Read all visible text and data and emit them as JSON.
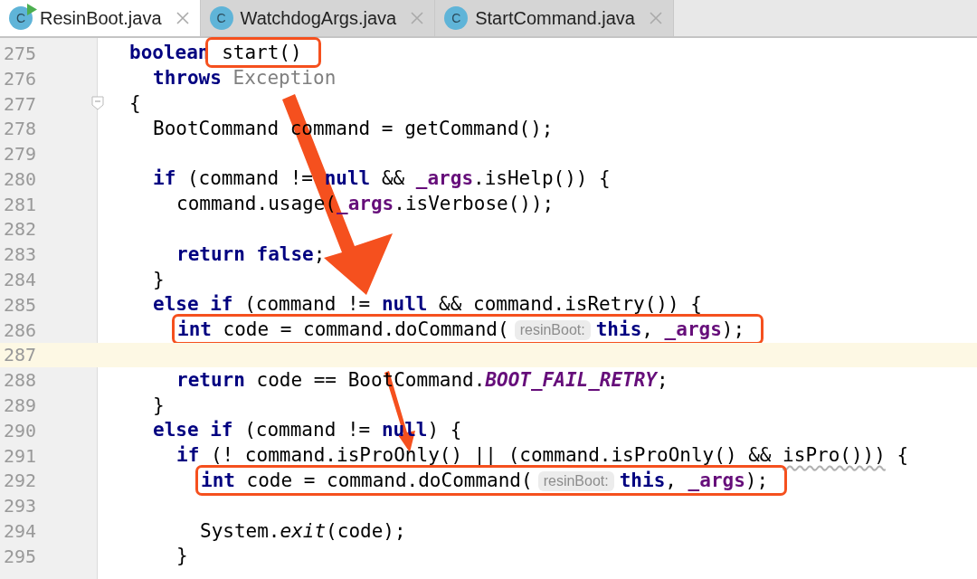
{
  "tabs": [
    {
      "label": "ResinBoot.java",
      "icon": "C",
      "runnable": true,
      "selected": true
    },
    {
      "label": "WatchdogArgs.java",
      "icon": "C",
      "runnable": false,
      "selected": false
    },
    {
      "label": "StartCommand.java",
      "icon": "C",
      "runnable": false,
      "selected": false
    }
  ],
  "editor": {
    "lines": [
      {
        "number": "275",
        "current": false,
        "fold": false,
        "tokens": [
          {
            "t": "boolean",
            "kind": "kw"
          },
          {
            "kind": "box",
            "tokens": [
              {
                "t": " start()",
                "kind": "plain"
              }
            ]
          }
        ],
        "children": [
          {
            "number": "276",
            "current": false,
            "fold": false,
            "tokens": [
              {
                "t": "throws",
                "kind": "kw"
              },
              {
                "t": " Exception",
                "kind": "gray"
              }
            ]
          }
        ]
      },
      {
        "number": "277",
        "current": false,
        "fold": true,
        "tokens": [
          {
            "t": "{",
            "kind": "plain"
          }
        ],
        "children": [
          {
            "number": "278",
            "current": false,
            "fold": false,
            "tokens": [
              {
                "t": "BootCommand command = getCommand();",
                "kind": "plain"
              }
            ]
          },
          {
            "number": "279",
            "current": false,
            "fold": false
          },
          {
            "number": "280",
            "current": false,
            "fold": false,
            "tokens": [
              {
                "t": "if",
                "kind": "kw"
              },
              {
                "t": " (command != ",
                "kind": "plain"
              },
              {
                "t": "null",
                "kind": "kw"
              },
              {
                "t": " && ",
                "kind": "plain"
              },
              {
                "t": "_args",
                "kind": "param"
              },
              {
                "t": ".isHelp()) {",
                "kind": "plain"
              }
            ],
            "children": [
              {
                "number": "281",
                "current": false,
                "fold": false,
                "tokens": [
                  {
                    "t": "command.usage(",
                    "kind": "plain"
                  },
                  {
                    "t": "_args",
                    "kind": "param"
                  },
                  {
                    "t": ".isVerbose());",
                    "kind": "plain"
                  }
                ]
              },
              {
                "number": "282",
                "current": false,
                "fold": false
              },
              {
                "number": "283",
                "current": false,
                "fold": false,
                "tokens": [
                  {
                    "t": "return false",
                    "kind": "kw"
                  },
                  {
                    "t": ";",
                    "kind": "plain"
                  }
                ]
              }
            ]
          },
          {
            "number": "284",
            "current": false,
            "fold": false,
            "tokens": [
              {
                "t": "}",
                "kind": "plain"
              }
            ]
          },
          {
            "number": "285",
            "current": false,
            "fold": false,
            "tokens": [
              {
                "t": "else if",
                "kind": "kw"
              },
              {
                "t": " (command != ",
                "kind": "plain"
              },
              {
                "t": "null",
                "kind": "kw"
              },
              {
                "t": " && command.isRetry()) {",
                "kind": "plain"
              }
            ],
            "children": [
              {
                "number": "286",
                "current": false,
                "fold": false,
                "tokens": [
                  {
                    "kind": "box",
                    "tokens": [
                      {
                        "t": "int",
                        "kind": "kw"
                      },
                      {
                        "t": " code = command.doCommand(",
                        "kind": "plain"
                      },
                      {
                        "t": "resinBoot:",
                        "kind": "hint"
                      },
                      {
                        "t": "this",
                        "kind": "kw"
                      },
                      {
                        "t": ", ",
                        "kind": "plain"
                      },
                      {
                        "t": "_args",
                        "kind": "param"
                      },
                      {
                        "t": ");",
                        "kind": "plain"
                      }
                    ]
                  }
                ]
              },
              {
                "number": "287",
                "current": true,
                "fold": false
              },
              {
                "number": "288",
                "current": false,
                "fold": false,
                "tokens": [
                  {
                    "t": "return",
                    "kind": "kw"
                  },
                  {
                    "t": " code == BootCommand.",
                    "kind": "plain"
                  },
                  {
                    "t": "BOOT_FAIL_RETRY",
                    "kind": "field"
                  },
                  {
                    "t": ";",
                    "kind": "plain"
                  }
                ]
              }
            ]
          },
          {
            "number": "289",
            "current": false,
            "fold": false,
            "tokens": [
              {
                "t": "}",
                "kind": "plain"
              }
            ]
          },
          {
            "number": "290",
            "current": false,
            "fold": false,
            "tokens": [
              {
                "t": "else if",
                "kind": "kw"
              },
              {
                "t": " (command != ",
                "kind": "plain"
              },
              {
                "t": "null",
                "kind": "kw"
              },
              {
                "t": ") {",
                "kind": "plain"
              }
            ],
            "children": [
              {
                "number": "291",
                "current": false,
                "fold": false,
                "tokens": [
                  {
                    "t": "if",
                    "kind": "kw"
                  },
                  {
                    "t": " (! command.isProOnly() || (command.isProOnly() && ",
                    "kind": "plain"
                  },
                  {
                    "t": "isPro()))",
                    "kind": "warn"
                  },
                  {
                    "t": " {",
                    "kind": "plain"
                  }
                ],
                "children": [
                  {
                    "number": "292",
                    "current": false,
                    "fold": false,
                    "tokens": [
                      {
                        "kind": "box",
                        "tokens": [
                          {
                            "t": "int",
                            "kind": "kw"
                          },
                          {
                            "t": " code = command.doCommand(",
                            "kind": "plain"
                          },
                          {
                            "t": "resinBoot:",
                            "kind": "hint"
                          },
                          {
                            "t": "this",
                            "kind": "kw"
                          },
                          {
                            "t": ", ",
                            "kind": "plain"
                          },
                          {
                            "t": "_args",
                            "kind": "param"
                          },
                          {
                            "t": ");",
                            "kind": "plain"
                          }
                        ]
                      }
                    ]
                  },
                  {
                    "number": "293",
                    "current": false,
                    "fold": false
                  },
                  {
                    "number": "294",
                    "current": false,
                    "fold": false,
                    "tokens": [
                      {
                        "t": "System.",
                        "kind": "plain"
                      },
                      {
                        "t": "exit",
                        "kind": "italic"
                      },
                      {
                        "t": "(code);",
                        "kind": "plain"
                      }
                    ]
                  }
                ]
              },
              {
                "number": "295",
                "current": false,
                "fold": false,
                "tokens": [
                  {
                    "t": "}",
                    "kind": "plain"
                  }
                ]
              }
            ]
          }
        ]
      }
    ]
  }
}
